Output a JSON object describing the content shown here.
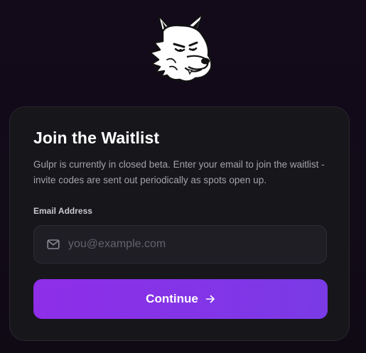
{
  "logo": {
    "icon": "wolf-mascot-icon"
  },
  "card": {
    "title": "Join the Waitlist",
    "description": "Gulpr is currently in closed beta. Enter your email to join the waitlist - invite codes are sent out periodically as spots open up."
  },
  "form": {
    "email_label": "Email Address",
    "email_placeholder": "you@example.com",
    "email_value": "",
    "email_icon": "mail-icon",
    "continue_label": "Continue",
    "continue_icon": "arrow-right-icon"
  },
  "colors": {
    "background": "#120b17",
    "card": "#17161b",
    "accent": "#8e2ee8",
    "accent_end": "#7a3ae6"
  }
}
